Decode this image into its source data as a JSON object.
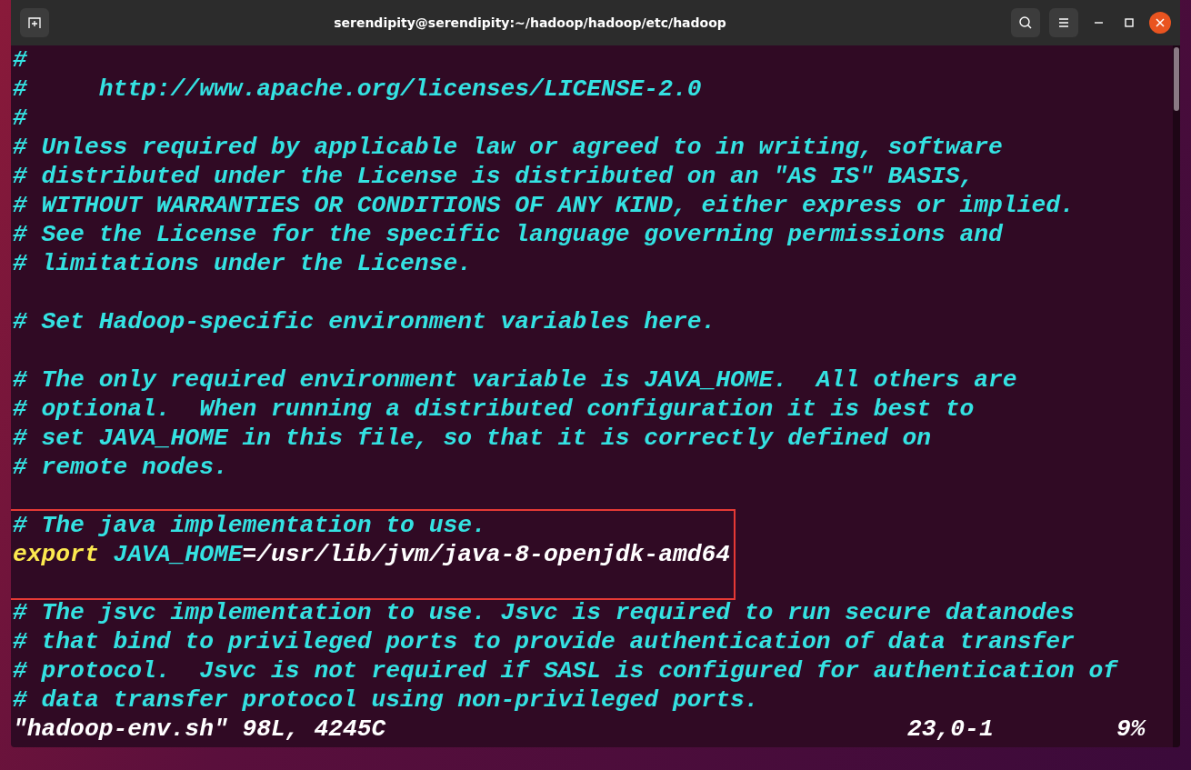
{
  "window": {
    "title": "serendipity@serendipity:~/hadoop/hadoop/etc/hadoop"
  },
  "sections": [
    {
      "highlighted": false,
      "lines": [
        {
          "kind": "comment",
          "text": "#"
        },
        {
          "kind": "comment",
          "text": "#     http://www.apache.org/licenses/LICENSE-2.0"
        },
        {
          "kind": "comment",
          "text": "#"
        },
        {
          "kind": "comment",
          "text": "# Unless required by applicable law or agreed to in writing, software"
        },
        {
          "kind": "comment",
          "text": "# distributed under the License is distributed on an \"AS IS\" BASIS,"
        },
        {
          "kind": "comment",
          "text": "# WITHOUT WARRANTIES OR CONDITIONS OF ANY KIND, either express or implied."
        },
        {
          "kind": "comment",
          "text": "# See the License for the specific language governing permissions and"
        },
        {
          "kind": "comment",
          "text": "# limitations under the License."
        },
        {
          "kind": "blank"
        },
        {
          "kind": "comment",
          "text": "# Set Hadoop-specific environment variables here."
        },
        {
          "kind": "blank"
        },
        {
          "kind": "comment",
          "text": "# The only required environment variable is JAVA_HOME.  All others are"
        },
        {
          "kind": "comment",
          "text": "# optional.  When running a distributed configuration it is best to"
        },
        {
          "kind": "comment",
          "text": "# set JAVA_HOME in this file, so that it is correctly defined on"
        },
        {
          "kind": "comment",
          "text": "# remote nodes."
        },
        {
          "kind": "blank"
        }
      ]
    },
    {
      "highlighted": true,
      "lines": [
        {
          "kind": "comment",
          "text": "# The java implementation to use."
        },
        {
          "kind": "export",
          "keyword": "export",
          "name": "JAVA_HOME",
          "value": "=/usr/lib/jvm/java-8-openjdk-amd64"
        },
        {
          "kind": "blank"
        }
      ]
    },
    {
      "highlighted": false,
      "lines": [
        {
          "kind": "comment",
          "text": "# The jsvc implementation to use. Jsvc is required to run secure datanodes"
        },
        {
          "kind": "comment",
          "text": "# that bind to privileged ports to provide authentication of data transfer"
        },
        {
          "kind": "comment",
          "text": "# protocol.  Jsvc is not required if SASL is configured for authentication of"
        },
        {
          "kind": "comment",
          "text": "# data transfer protocol using non-privileged ports."
        }
      ]
    }
  ],
  "status_bar": {
    "file_info": "\"hadoop-env.sh\" 98L, 4245C",
    "cursor_position": "23,0-1",
    "scroll_percent": "9%"
  }
}
